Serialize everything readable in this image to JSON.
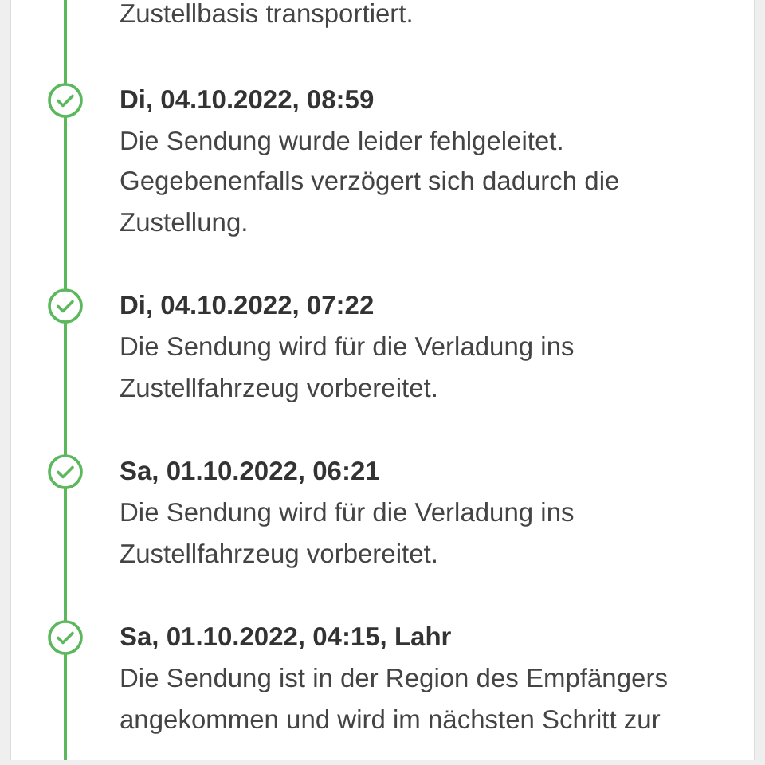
{
  "previous_event_tail": "Zustellbasis transportiert.",
  "events": [
    {
      "heading": "Di, 04.10.2022, 08:59",
      "description": "Die Sendung wurde leider fehlgeleitet.\nGegebenenfalls verzögert sich dadurch die\nZustellung.",
      "done": true
    },
    {
      "heading": "Di, 04.10.2022, 07:22",
      "description": "Die Sendung wird für die Verladung ins\nZustellfahrzeug vorbereitet.",
      "done": true
    },
    {
      "heading": "Sa, 01.10.2022, 06:21",
      "description": "Die Sendung wird für die Verladung ins\nZustellfahrzeug vorbereitet.",
      "done": true
    },
    {
      "heading": "Sa, 01.10.2022, 04:15, Lahr",
      "description": "Die Sendung ist in der Region des Empfängers\nangekommen und wird im nächsten Schritt zur",
      "done": true
    }
  ]
}
